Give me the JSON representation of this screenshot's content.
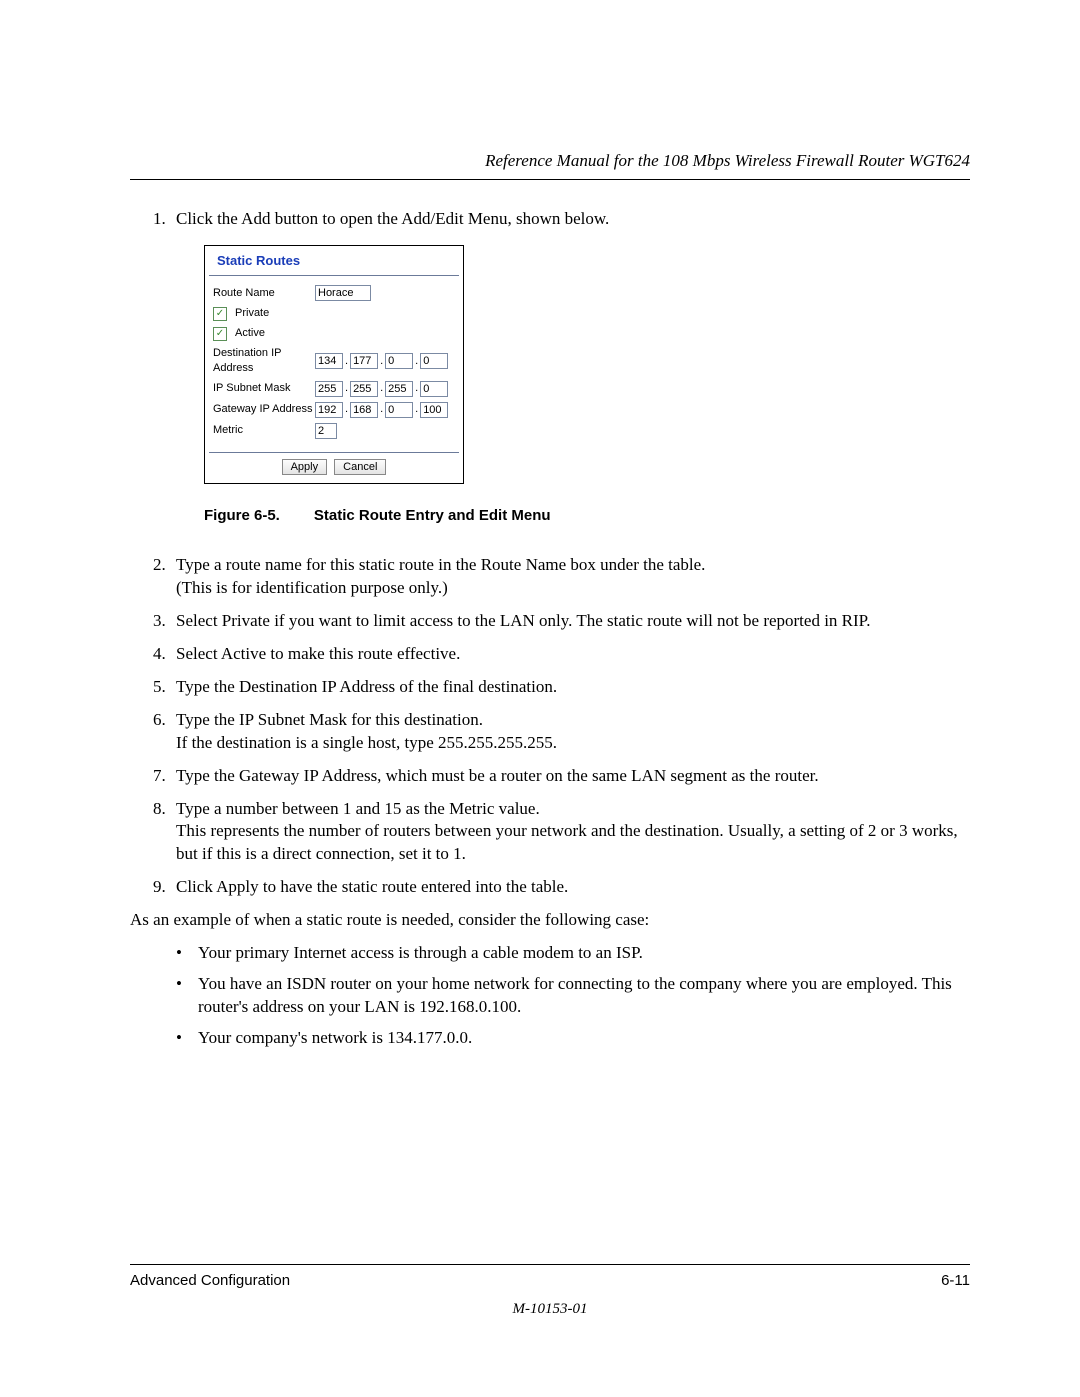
{
  "header": "Reference Manual for the 108 Mbps Wireless Firewall Router WGT624",
  "steps": {
    "s1": "Click the Add button to open the Add/Edit Menu, shown below.",
    "s2a": "Type a route name for this static route in the Route Name box under the table.",
    "s2b": "(This is for identification purpose only.)",
    "s3": "Select Private if you want to limit access to the LAN only. The static route will not be reported in RIP.",
    "s4": "Select Active to make this route effective.",
    "s5": "Type the Destination IP Address of the final destination.",
    "s6a": "Type the IP Subnet Mask for this destination.",
    "s6b": "If the destination is a single host, type 255.255.255.255.",
    "s7": "Type the Gateway IP Address, which must be a router on the same LAN segment as the router.",
    "s8a": "Type a number between 1 and 15 as the Metric value.",
    "s8b": "This represents the number of routers between your network and the destination. Usually, a setting of 2 or 3 works, but if this is a direct connection, set it to 1.",
    "s9": "Click Apply to have the static route entered into the table."
  },
  "example_intro": "As an example of when a static route is needed, consider the following case:",
  "bullets": {
    "b1": "Your primary Internet access is through a cable modem to an ISP.",
    "b2": "You have an ISDN router on your home network for connecting to the company where you are employed. This router's address on your LAN is 192.168.0.100.",
    "b3": "Your company's network is 134.177.0.0."
  },
  "figure": {
    "label": "Figure 6-5.",
    "caption": "Static Route Entry and Edit Menu"
  },
  "panel": {
    "title": "Static Routes",
    "labels": {
      "route_name": "Route Name",
      "private": "Private",
      "active": "Active",
      "dest": "Destination IP Address",
      "mask": "IP Subnet Mask",
      "gateway": "Gateway IP Address",
      "metric": "Metric"
    },
    "values": {
      "route_name": "Horace",
      "dest": [
        "134",
        "177",
        "0",
        "0"
      ],
      "mask": [
        "255",
        "255",
        "255",
        "0"
      ],
      "gateway": [
        "192",
        "168",
        "0",
        "100"
      ],
      "metric": "2"
    },
    "buttons": {
      "apply": "Apply",
      "cancel": "Cancel"
    }
  },
  "footer": {
    "left": "Advanced Configuration",
    "right": "6-11",
    "docnum": "M-10153-01"
  }
}
